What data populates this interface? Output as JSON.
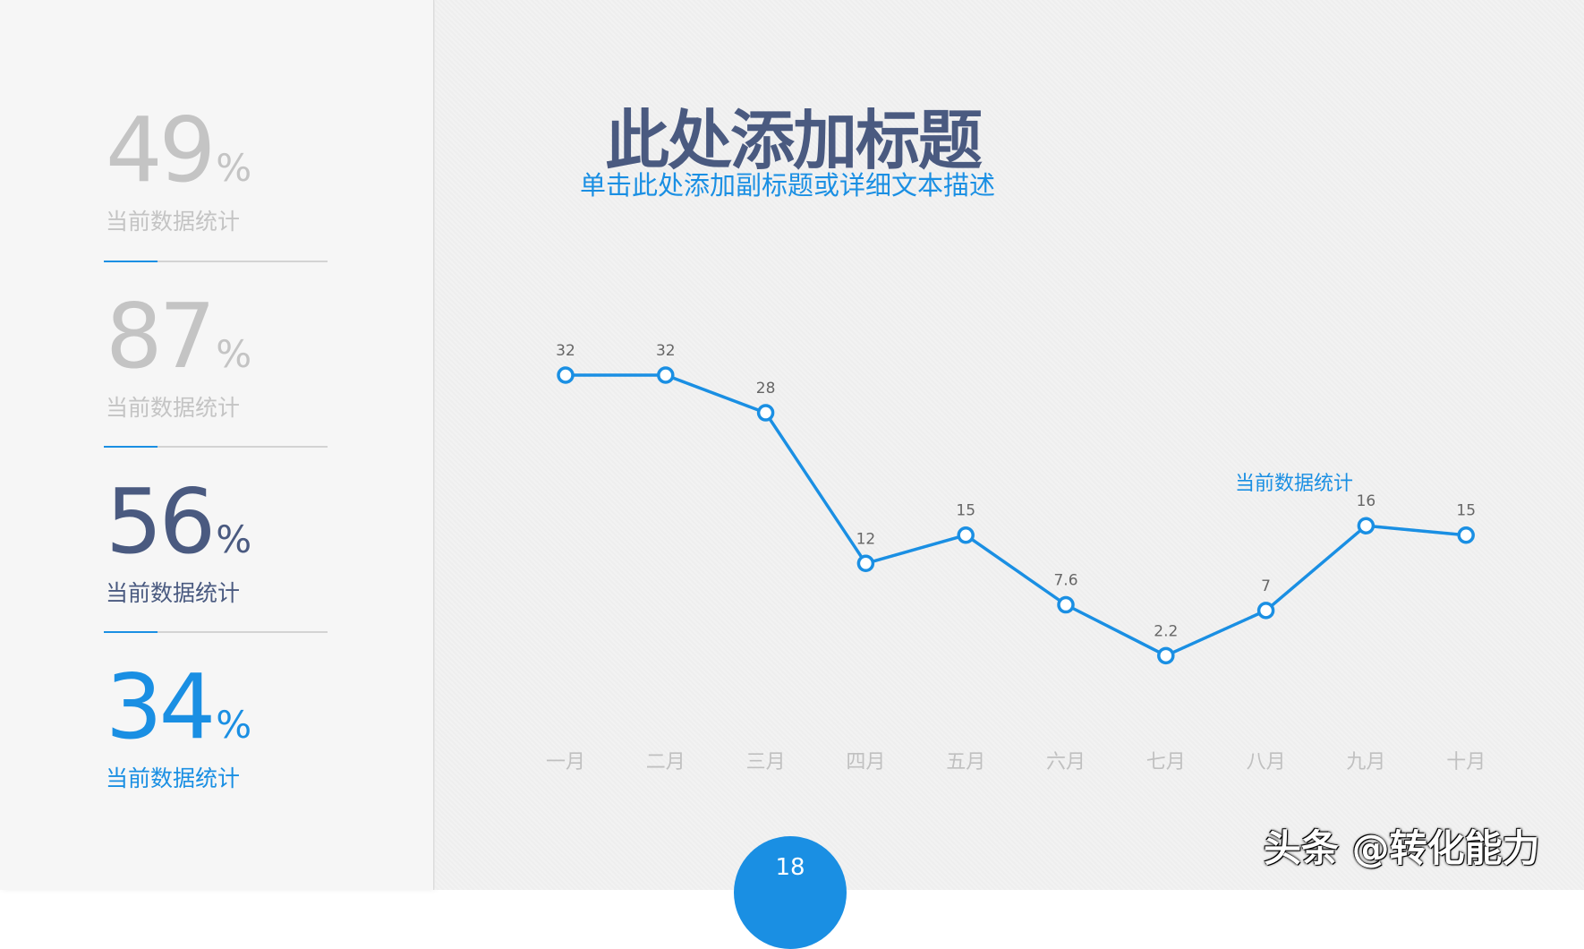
{
  "slide": {
    "title": "此处添加标题",
    "subtitle": "单击此处添加副标题或详细文本描述",
    "page_number": "18",
    "watermark": "头条 @转化能力"
  },
  "stats": [
    {
      "value": "49",
      "unit": "%",
      "label": "当前数据统计",
      "color": "#c4c4c4"
    },
    {
      "value": "87",
      "unit": "%",
      "label": "当前数据统计",
      "color": "#c4c4c4"
    },
    {
      "value": "56",
      "unit": "%",
      "label": "当前数据统计",
      "color": "#4a5a80"
    },
    {
      "value": "34",
      "unit": "%",
      "label": "当前数据统计",
      "color": "#1a8fe3"
    }
  ],
  "colors": {
    "accent": "#1a8fe3",
    "title": "#4a5a80",
    "muted": "#c4c4c4",
    "axis_text": "#c0c0c0",
    "data_label": "#666666"
  },
  "chart_data": {
    "type": "line",
    "title": "",
    "xlabel": "",
    "ylabel": "",
    "categories": [
      "一月",
      "二月",
      "三月",
      "四月",
      "五月",
      "六月",
      "七月",
      "八月",
      "九月",
      "十月"
    ],
    "series": [
      {
        "name": "当前数据统计",
        "values": [
          32,
          32,
          28,
          12,
          15,
          7.6,
          2.2,
          7,
          16,
          15
        ]
      }
    ],
    "ylim": [
      -3,
      32
    ],
    "grid": false,
    "legend": "right"
  }
}
